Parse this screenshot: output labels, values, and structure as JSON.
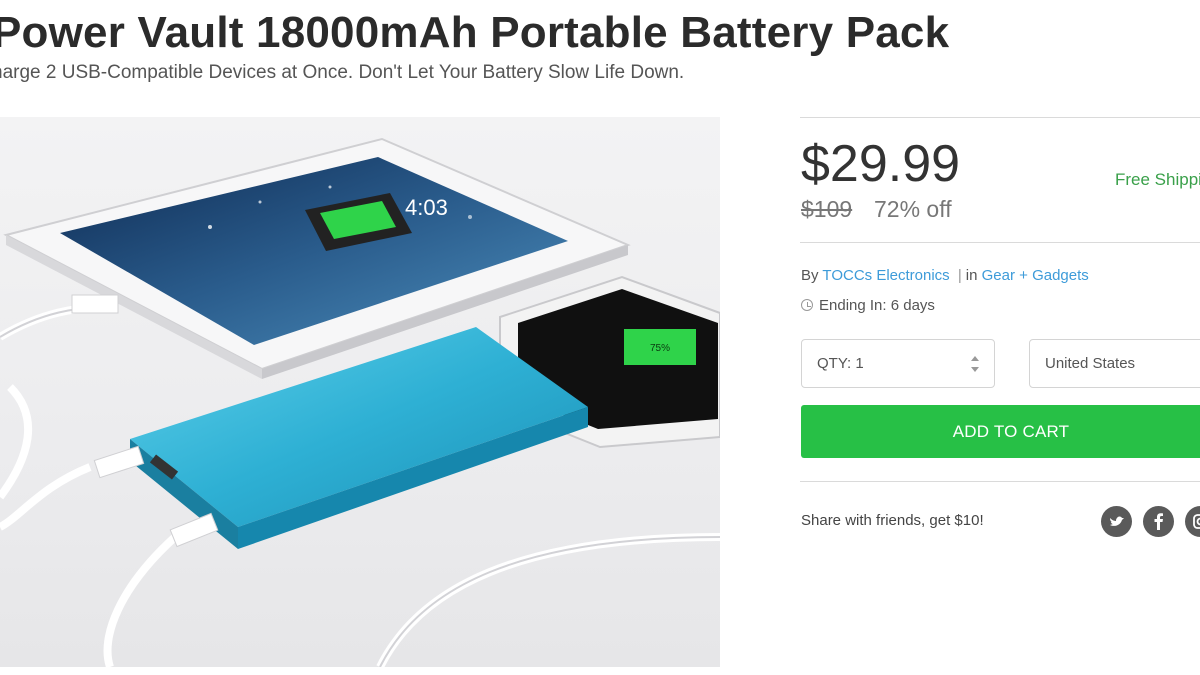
{
  "product": {
    "title": "Power Vault 18000mAh Portable Battery Pack",
    "subtitle": "harge 2 USB-Compatible Devices at Once. Don't Let Your Battery Slow Life Down."
  },
  "pricing": {
    "price": "$29.99",
    "original_price": "$109",
    "discount": "72% off",
    "shipping": "Free Shippi"
  },
  "meta": {
    "by_label": "By",
    "vendor": "TOCCs Electronics",
    "separator": "|",
    "in_label": "in",
    "category": "Gear + Gadgets",
    "ending": "Ending In: 6 days"
  },
  "form": {
    "qty_label": "QTY: 1",
    "country": "United States"
  },
  "cart": {
    "label": "ADD TO CART"
  },
  "share": {
    "text": "Share with friends, get $10!"
  },
  "hero_image": {
    "lock_time": "4:03",
    "phone_percent": "75%"
  },
  "icons": {
    "twitter": "twitter-icon",
    "facebook": "facebook-icon",
    "instagram": "instagram-icon",
    "clock": "clock-icon"
  },
  "colors": {
    "accent_green": "#27c046",
    "link_blue": "#3d9bd9",
    "battery_blue": "#33b4d4",
    "shipping_green": "#3aa04a"
  }
}
